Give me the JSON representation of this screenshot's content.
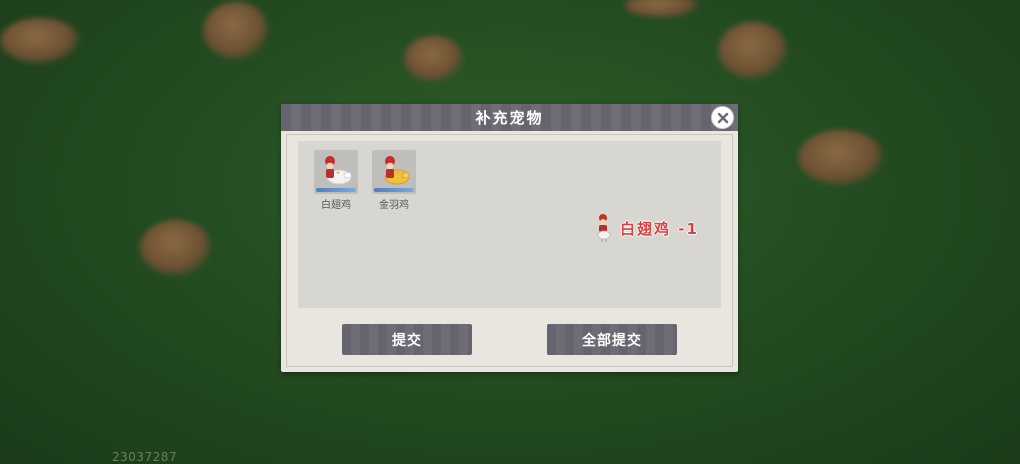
{
  "dialog": {
    "title": "补充宠物",
    "pets": [
      {
        "name": "白翅鸡",
        "icon": "white-wing-chicken-icon",
        "color": "#f2f2f2"
      },
      {
        "name": "金羽鸡",
        "icon": "golden-feather-chicken-icon",
        "color": "#f0c23b"
      }
    ],
    "notice": {
      "text": "白翅鸡 -1",
      "icon": "white-wing-chicken-icon",
      "color": "#d94040"
    },
    "buttons": {
      "submit_label": "提交",
      "submit_all_label": "全部提交"
    }
  },
  "build_id": "23037287"
}
